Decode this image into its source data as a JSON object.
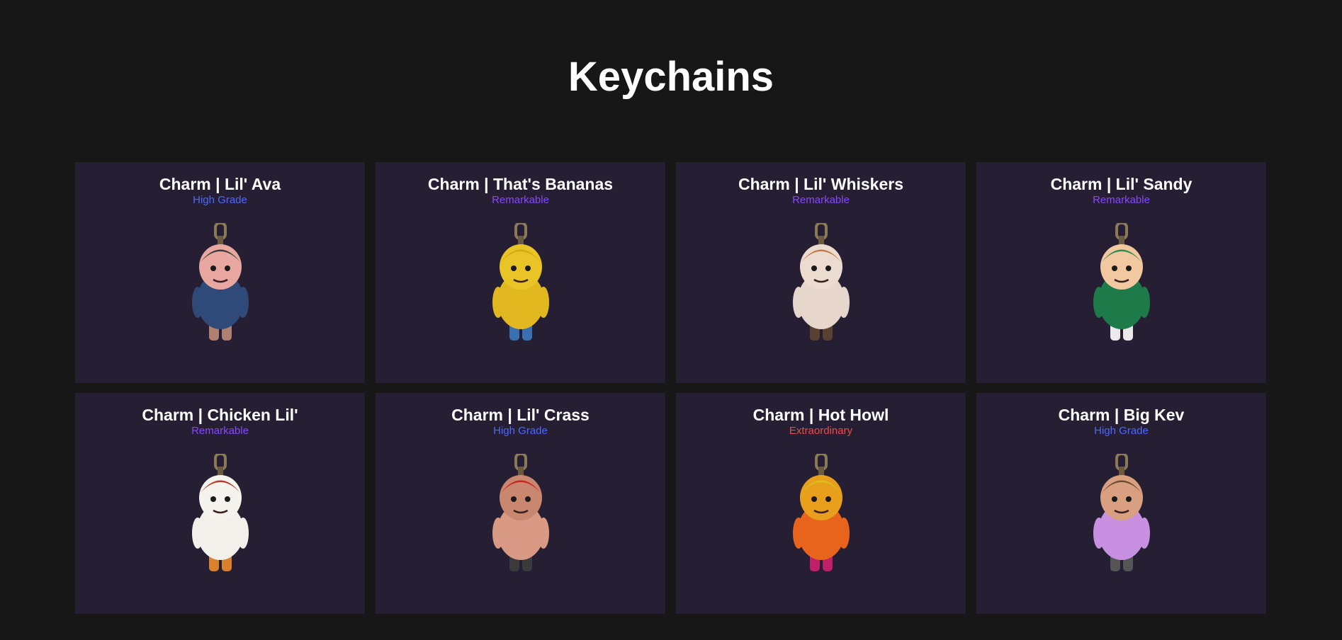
{
  "page": {
    "title": "Keychains"
  },
  "rarity_colors": {
    "High Grade": "#4b69ff",
    "Remarkable": "#8847ff",
    "Extraordinary": "#eb4b4b"
  },
  "items": [
    {
      "name": "Charm | Lil' Ava",
      "rarity": "High Grade",
      "icon": "lil-ava-charm-icon",
      "body": "#2f4a78",
      "head": "#e8a7a0",
      "hair": "#3b3b3b",
      "detail": "#b08070"
    },
    {
      "name": "Charm | That's Bananas",
      "rarity": "Remarkable",
      "icon": "thats-bananas-charm-icon",
      "body": "#e2b820",
      "head": "#e8c426",
      "hair": "#d4a80f",
      "detail": "#3a6fb0"
    },
    {
      "name": "Charm | Lil' Whiskers",
      "rarity": "Remarkable",
      "icon": "lil-whiskers-charm-icon",
      "body": "#e6d6cc",
      "head": "#ecdcd0",
      "hair": "#c47a4a",
      "detail": "#5a4030"
    },
    {
      "name": "Charm | Lil' Sandy",
      "rarity": "Remarkable",
      "icon": "lil-sandy-charm-icon",
      "body": "#1f7a4a",
      "head": "#f2c8a0",
      "hair": "#2f8a50",
      "detail": "#eaeaea"
    },
    {
      "name": "Charm | Chicken Lil'",
      "rarity": "Remarkable",
      "icon": "chicken-lil-charm-icon",
      "body": "#f2f0ea",
      "head": "#f5f3ee",
      "hair": "#b83a2a",
      "detail": "#d9822b"
    },
    {
      "name": "Charm | Lil' Crass",
      "rarity": "High Grade",
      "icon": "lil-crass-charm-icon",
      "body": "#d99a85",
      "head": "#c9876f",
      "hair": "#cc2222",
      "detail": "#3a3a3a"
    },
    {
      "name": "Charm | Hot Howl",
      "rarity": "Extraordinary",
      "icon": "hot-howl-charm-icon",
      "body": "#e8641c",
      "head": "#e8a01c",
      "hair": "#d8c020",
      "detail": "#c0206a"
    },
    {
      "name": "Charm | Big Kev",
      "rarity": "High Grade",
      "icon": "big-kev-charm-icon",
      "body": "#c890e0",
      "head": "#d8a080",
      "hair": "#6a4a30",
      "detail": "#555555"
    }
  ]
}
